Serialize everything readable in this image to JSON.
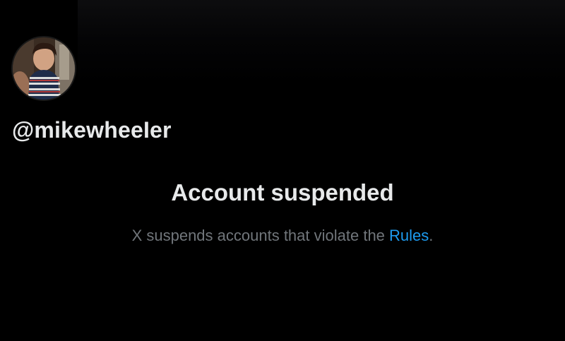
{
  "profile": {
    "handle": "@mikewheeIer"
  },
  "suspension": {
    "title": "Account suspended",
    "message_prefix": "X suspends accounts that violate the ",
    "rules_link": "Rules",
    "message_suffix": "."
  },
  "colors": {
    "background": "#000000",
    "primary_text": "#e7e9ea",
    "secondary_text": "#71767b",
    "link": "#1d9bf0"
  }
}
